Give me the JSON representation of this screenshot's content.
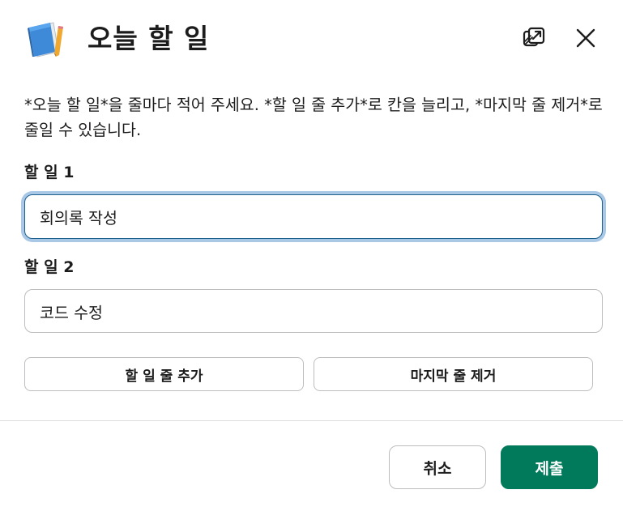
{
  "header": {
    "title": "오늘 할 일",
    "app_icon": "notebook-icon",
    "popout_icon": "open-in-window-icon",
    "close_icon": "close-icon"
  },
  "description": "*오늘 할 일*을 줄마다 적어 주세요. *할 일 줄 추가*로 칸을 늘리고, *마지막 줄 제거*로 줄일 수 있습니다.",
  "fields": [
    {
      "label": "할 일 1",
      "value": "회의록 작성",
      "focused": true
    },
    {
      "label": "할 일 2",
      "value": "코드 수정",
      "focused": false
    }
  ],
  "actions": {
    "add_row_label": "할 일 줄 추가",
    "remove_row_label": "마지막 줄 제거"
  },
  "footer": {
    "cancel_label": "취소",
    "submit_label": "제출"
  },
  "colors": {
    "primary": "#007a5a",
    "focus_ring": "#a8c8e6",
    "focus_border": "#1d5f8d",
    "text": "#1d1c1d",
    "border": "#bdbdbf"
  }
}
